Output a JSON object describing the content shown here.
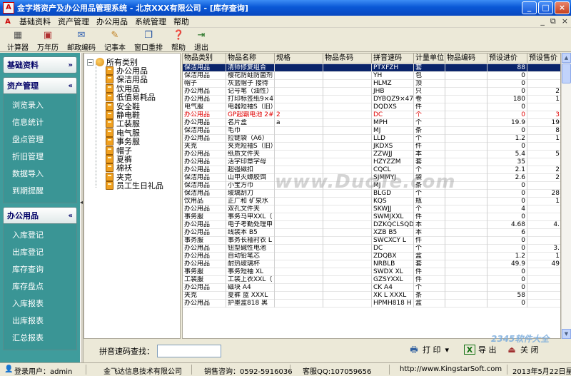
{
  "window": {
    "title": "金字塔资产及办公用品管理系统 - 北京XXX有限公司 - [库存查询]",
    "buttons": [
      "_",
      "□",
      "×"
    ]
  },
  "menu": {
    "items": [
      "基础资料",
      "资产管理",
      "办公用品",
      "系统管理",
      "帮助"
    ],
    "mdi_buttons": [
      "_",
      "⧉",
      "×"
    ]
  },
  "toolbar": {
    "buttons": [
      {
        "label": "计算器",
        "icon": "calculator-icon"
      },
      {
        "label": "万年历",
        "icon": "calendar-icon"
      },
      {
        "label": "邮政编码",
        "icon": "postcode-icon"
      },
      {
        "label": "记事本",
        "icon": "notepad-icon"
      },
      {
        "label": "窗口重排",
        "icon": "window-arrange-icon"
      },
      {
        "label": "帮助",
        "icon": "help-icon"
      },
      {
        "label": "退出",
        "icon": "exit-icon"
      }
    ]
  },
  "sidebar": {
    "groups": [
      {
        "title": "基础资料",
        "chevron": "»",
        "items": []
      },
      {
        "title": "资产管理",
        "chevron": "«",
        "items": [
          "浏览录入",
          "信息统计",
          "盘点管理",
          "折旧管理",
          "数据导入",
          "到期提醒"
        ]
      },
      {
        "title": "办公用品",
        "chevron": "«",
        "items": [
          "入库登记",
          "出库登记",
          "库存查询",
          "库存盘点",
          "入库报表",
          "出库报表",
          "汇总报表"
        ]
      }
    ]
  },
  "tree": {
    "root": "所有类别",
    "expander": "−",
    "nodes": [
      "办公用品",
      "保洁用品",
      "饮用品",
      "低值易耗品",
      "安全鞋",
      "静电鞋",
      "工装服",
      "电气服",
      "事务服",
      "帽子",
      "夏裤",
      "棉袄",
      "夹克",
      "员工生日礼品"
    ]
  },
  "grid": {
    "columns": [
      "物品类别",
      "物品名称",
      "规格",
      "物品条码",
      "拼音速码",
      "计量单位",
      "物品编码",
      "预设进价",
      "预设售价"
    ],
    "rows": [
      [
        "保洁用品",
        "清师修复组合",
        "",
        "",
        "PTXFZH",
        "套",
        "",
        "88",
        ""
      ],
      [
        "保洁用品",
        "樱花防蛀防菌剂",
        "",
        "",
        "YH",
        "包",
        "",
        "0",
        ""
      ],
      [
        "帽子",
        "灰蓝帽子 接待",
        "",
        "",
        "HLMZ",
        "顶",
        "",
        "0",
        ""
      ],
      [
        "办公用品",
        "记号笔（油性）",
        "",
        "",
        "JHB",
        "只",
        "",
        "0",
        "2"
      ],
      [
        "办公用品",
        "打印标签纸9×47",
        "",
        "",
        "DYBQZ9×47",
        "卷",
        "",
        "180",
        "1"
      ],
      [
        "电气服",
        "电器短袖S（旧）",
        "",
        "",
        "DQDXS",
        "件",
        "",
        "0",
        ""
      ],
      [
        "办公用品",
        "GP超霸电池 2#",
        "2",
        "",
        "DC",
        "个",
        "",
        "0",
        "3"
      ],
      [
        "办公用品",
        "名片盒",
        "a",
        "",
        "MPH",
        "个",
        "",
        "19.9",
        "19"
      ],
      [
        "保洁用品",
        "毛巾",
        "",
        "",
        "MJ",
        "条",
        "",
        "0",
        "8"
      ],
      [
        "办公用品",
        "拉链袋（A6）",
        "",
        "",
        "LLD",
        "个",
        "",
        "1.2",
        "1"
      ],
      [
        "夹克",
        "夹克短袖S（旧）",
        "",
        "",
        "JKDXS",
        "件",
        "",
        "0",
        ""
      ],
      [
        "办公用品",
        "纸质文件夹",
        "",
        "",
        "ZZWJJ",
        "本",
        "",
        "5.4",
        "5"
      ],
      [
        "办公用品",
        "活字印章字母",
        "",
        "",
        "HZYZZM",
        "套",
        "",
        "35",
        ""
      ],
      [
        "办公用品",
        "超强磁扣",
        "",
        "",
        "CQCL",
        "个",
        "",
        "2.1",
        "2"
      ],
      [
        "保洁用品",
        "山甲灭蟑胶饵",
        "",
        "",
        "SJMMYJ",
        "袋",
        "",
        "2.6",
        "2"
      ],
      [
        "保洁用品",
        "小宝方巾",
        "",
        "",
        "MJ",
        "条",
        "",
        "0",
        ""
      ],
      [
        "保洁用品",
        "玻璃刮刀",
        "",
        "",
        "BLGD",
        "个",
        "",
        "0",
        "28"
      ],
      [
        "饮用品",
        "正广和 矿泉水",
        "",
        "",
        "KQS",
        "瓶",
        "",
        "0",
        "1"
      ],
      [
        "办公用品",
        "双孔文件夹",
        "",
        "",
        "SKWJJ",
        "个",
        "",
        "4",
        ""
      ],
      [
        "事务服",
        "事务马甲XXL（",
        "",
        "",
        "SWMJXXL",
        "件",
        "",
        "0",
        ""
      ],
      [
        "办公用品",
        "电子考勤处理申",
        "",
        "",
        "DZKQCLSQD",
        "本",
        "",
        "4.68",
        "4."
      ],
      [
        "办公用品",
        "线装本 B5",
        "",
        "",
        "XZB B5",
        "本",
        "",
        "6",
        ""
      ],
      [
        "事务服",
        "事务长袖衬衣 L",
        "",
        "",
        "SWCXCY L",
        "件",
        "",
        "0",
        ""
      ],
      [
        "办公用品",
        "钮型碱性电池",
        "",
        "",
        "DC",
        "个",
        "",
        "0",
        "3."
      ],
      [
        "办公用品",
        "自动铅笔芯",
        "",
        "",
        "ZDQBX",
        "盒",
        "",
        "1.2",
        "1"
      ],
      [
        "办公用品",
        "耐热玻璃杯",
        "",
        "",
        "NRBLB",
        "套",
        "",
        "49.9",
        "49"
      ],
      [
        "事务服",
        "事务短袖 XL",
        "",
        "",
        "SWDX XL",
        "件",
        "",
        "0",
        ""
      ],
      [
        "工装服",
        "工装上衣XXL（",
        "",
        "",
        "GZSYXXL",
        "件",
        "",
        "0",
        ""
      ],
      [
        "办公用品",
        "磁块 A4",
        "",
        "",
        "CK A4",
        "个",
        "",
        "0",
        ""
      ],
      [
        "夹克",
        "夏裤 蓝 XXXL",
        "",
        "",
        "XK L XXXL",
        "条",
        "",
        "58",
        ""
      ],
      [
        "办公用品",
        "护墨盒818 黑",
        "",
        "",
        "HPMH818 H",
        "盒",
        "",
        "0",
        ""
      ]
    ]
  },
  "bottom": {
    "search_label": "拼音速码查找：",
    "search_value": "",
    "print_label": "打 印",
    "print_arrow": "▾",
    "export_label": "导 出",
    "close_label": "关 闭"
  },
  "statusbar": {
    "login": "登录用户：admin",
    "company": "金飞达信息技术有限公司",
    "sales": "销售咨询：0592-5916036",
    "qq": "客服QQ:107059656",
    "website": "http://www.KingstarSoft.com",
    "date": "2013年5月22日星期三"
  },
  "watermarks": {
    "center": "www.DuoTe.com",
    "corner": "2345软件大全"
  },
  "colors": {
    "titlebar": "#0a58d6",
    "sidebar": "#3f9c9c",
    "selection": "#0a246a",
    "alert_row": "#e00000"
  }
}
